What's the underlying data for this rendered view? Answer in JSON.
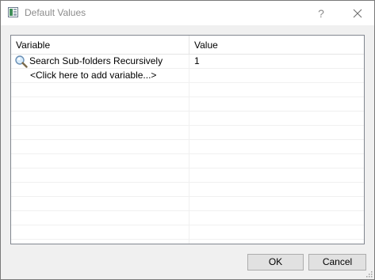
{
  "window": {
    "title": "Default Values",
    "help_glyph": "?",
    "app_icon": "dialog-app-icon"
  },
  "table": {
    "columns": [
      "Variable",
      "Value"
    ],
    "rows": [
      {
        "icon": "magnifier-icon",
        "variable": "Search Sub-folders Recursively",
        "value": "1"
      }
    ],
    "add_row_label": "<Click here to add variable...>"
  },
  "buttons": {
    "ok_label": "OK",
    "cancel_label": "Cancel"
  }
}
